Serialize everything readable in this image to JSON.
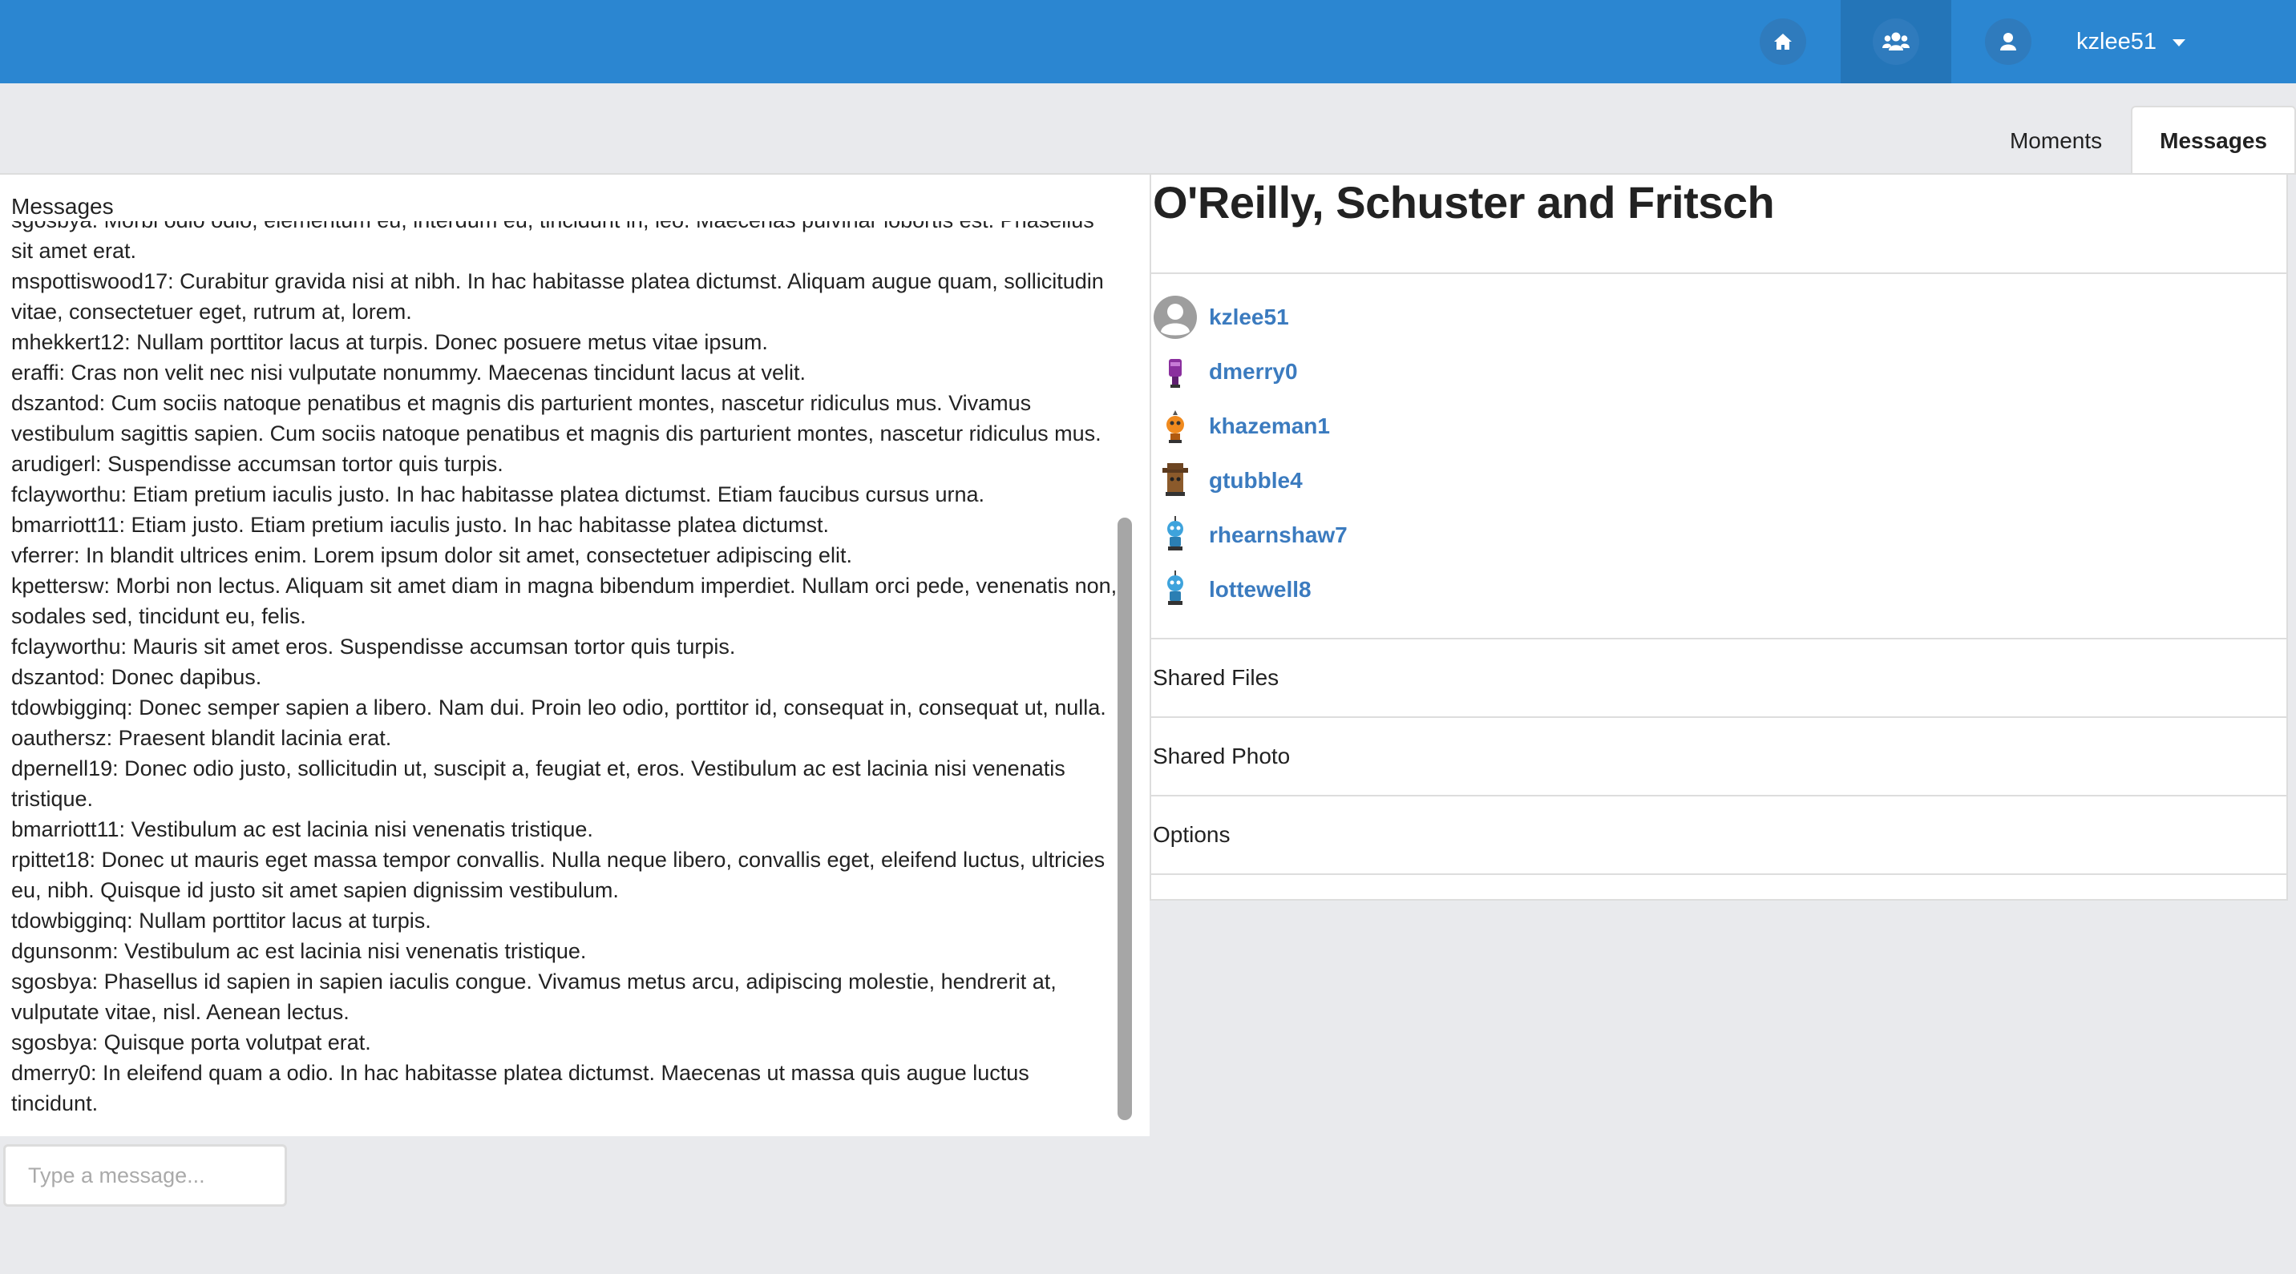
{
  "navbar": {
    "user_name": "kzlee51",
    "icons": [
      "home-icon",
      "group-icon",
      "user-icon"
    ]
  },
  "tabs": [
    {
      "label": "Moments",
      "active": false
    },
    {
      "label": "Messages",
      "active": true
    }
  ],
  "chat": {
    "title": "Messages",
    "placeholder": "Type a message...",
    "messages": [
      "sgosbya: Morbi odio odio, elementum eu, interdum eu, tincidunt in, leo. Maecenas pulvinar lobortis est. Phasellus sit amet erat.",
      "mspottiswood17: Curabitur gravida nisi at nibh. In hac habitasse platea dictumst. Aliquam augue quam, sollicitudin vitae, consectetuer eget, rutrum at, lorem.",
      "mhekkert12: Nullam porttitor lacus at turpis. Donec posuere metus vitae ipsum.",
      "eraffi: Cras non velit nec nisi vulputate nonummy. Maecenas tincidunt lacus at velit.",
      "dszantod: Cum sociis natoque penatibus et magnis dis parturient montes, nascetur ridiculus mus. Vivamus vestibulum sagittis sapien. Cum sociis natoque penatibus et magnis dis parturient montes, nascetur ridiculus mus.",
      "arudigerl: Suspendisse accumsan tortor quis turpis.",
      "fclayworthu: Etiam pretium iaculis justo. In hac habitasse platea dictumst. Etiam faucibus cursus urna.",
      "bmarriott11: Etiam justo. Etiam pretium iaculis justo. In hac habitasse platea dictumst.",
      "vferrer: In blandit ultrices enim. Lorem ipsum dolor sit amet, consectetuer adipiscing elit.",
      "kpettersw: Morbi non lectus. Aliquam sit amet diam in magna bibendum imperdiet. Nullam orci pede, venenatis non, sodales sed, tincidunt eu, felis.",
      "fclayworthu: Mauris sit amet eros. Suspendisse accumsan tortor quis turpis.",
      "dszantod: Donec dapibus.",
      "tdowbigginq: Donec semper sapien a libero. Nam dui. Proin leo odio, porttitor id, consequat in, consequat ut, nulla.",
      "oauthersz: Praesent blandit lacinia erat.",
      "dpernell19: Donec odio justo, sollicitudin ut, suscipit a, feugiat et, eros. Vestibulum ac est lacinia nisi venenatis tristique.",
      "bmarriott11: Vestibulum ac est lacinia nisi venenatis tristique.",
      "rpittet18: Donec ut mauris eget massa tempor convallis. Nulla neque libero, convallis eget, eleifend luctus, ultricies eu, nibh. Quisque id justo sit amet sapien dignissim vestibulum.",
      "tdowbigginq: Nullam porttitor lacus at turpis.",
      "dgunsonm: Vestibulum ac est lacinia nisi venenatis tristique.",
      "sgosbya: Phasellus id sapien in sapien iaculis congue. Vivamus metus arcu, adipiscing molestie, hendrerit at, vulputate vitae, nisl. Aenean lectus.",
      "sgosbya: Quisque porta volutpat erat.",
      "dmerry0: In eleifend quam a odio. In hac habitasse platea dictumst. Maecenas ut massa quis augue luctus tincidunt."
    ]
  },
  "group": {
    "title": "O'Reilly, Schuster and Fritsch",
    "members": [
      {
        "name": "kzlee51",
        "avatar": "default-avatar-icon"
      },
      {
        "name": "dmerry0",
        "avatar": "purple-robot-avatar-icon"
      },
      {
        "name": "khazeman1",
        "avatar": "orange-robot-avatar-icon"
      },
      {
        "name": "gtubble4",
        "avatar": "brown-robot-avatar-icon"
      },
      {
        "name": "rhearnshaw7",
        "avatar": "blue-robot-avatar-icon"
      },
      {
        "name": "lottewell8",
        "avatar": "blue-robot-avatar-icon"
      }
    ],
    "sections": [
      "Shared Files",
      "Shared Photo",
      "Options"
    ]
  }
}
